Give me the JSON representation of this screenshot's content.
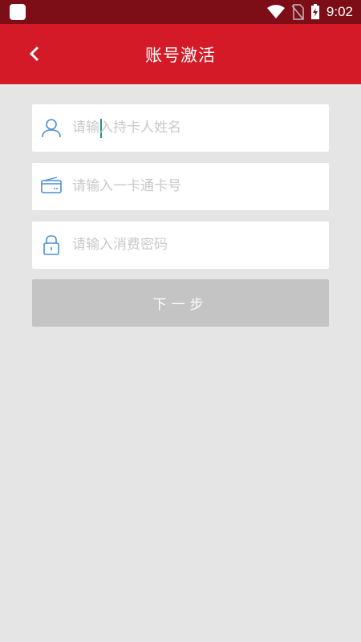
{
  "status_bar": {
    "time": "9:02"
  },
  "header": {
    "title": "账号激活"
  },
  "form": {
    "name_placeholder": "请输入持卡人姓名",
    "card_placeholder": "请输入一卡通卡号",
    "password_placeholder": "请输入消费密码",
    "next_label": "下一步"
  }
}
